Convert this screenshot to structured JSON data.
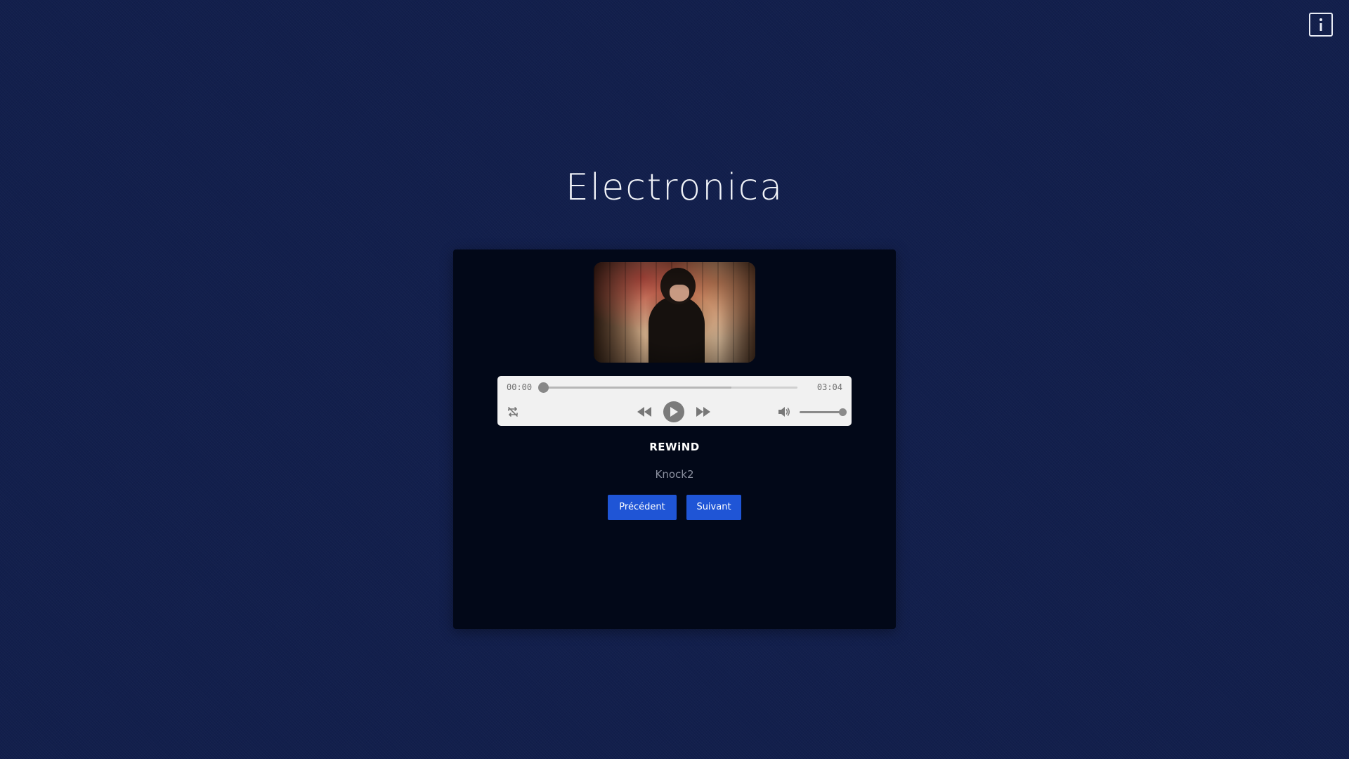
{
  "page": {
    "title": "Electronica",
    "background_color": "#121f4c"
  },
  "info_button": {
    "icon": "info-icon"
  },
  "player": {
    "card_color": "#020818",
    "cover": {
      "icon": "album-cover"
    },
    "audio": {
      "current_time": "00:00",
      "total_time": "03:04",
      "progress": 0.0,
      "buffered": 0.74,
      "volume": 1.0,
      "icons": {
        "loop": "loop-off-icon",
        "rewind": "rewind-icon",
        "play": "play-icon",
        "forward": "fast-forward-icon",
        "volume": "volume-icon"
      }
    },
    "track": {
      "title": "REWiND",
      "artist": "Knock2"
    },
    "buttons": {
      "previous_label": "Précédent",
      "next_label": "Suivant",
      "accent_color": "#1f55d6"
    }
  }
}
